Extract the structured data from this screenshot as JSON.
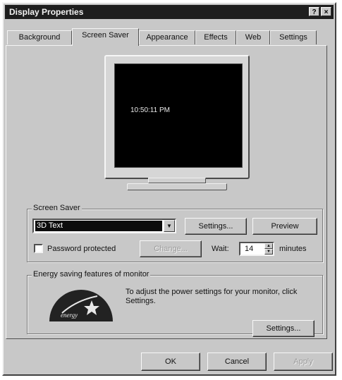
{
  "window": {
    "title": "Display Properties",
    "help_button": "?",
    "close_button": "×"
  },
  "tabs": [
    {
      "label": "Background"
    },
    {
      "label": "Screen Saver"
    },
    {
      "label": "Appearance"
    },
    {
      "label": "Effects"
    },
    {
      "label": "Web"
    },
    {
      "label": "Settings"
    }
  ],
  "preview": {
    "clock_text": "10:50:11 PM"
  },
  "screen_saver": {
    "group_label": "Screen Saver",
    "selected": "3D Text",
    "settings_label": "Settings...",
    "preview_label": "Preview",
    "password_label": "Password protected",
    "password_checked": false,
    "change_label": "Change...",
    "wait_label": "Wait:",
    "wait_value": "14",
    "minutes_label": "minutes"
  },
  "energy": {
    "group_label": "Energy saving features of monitor",
    "description": "To adjust the power settings for your monitor, click Settings.",
    "settings_label": "Settings...",
    "logo_icon": "energy-star-icon"
  },
  "footer": {
    "ok_label": "OK",
    "cancel_label": "Cancel",
    "apply_label": "Apply"
  }
}
